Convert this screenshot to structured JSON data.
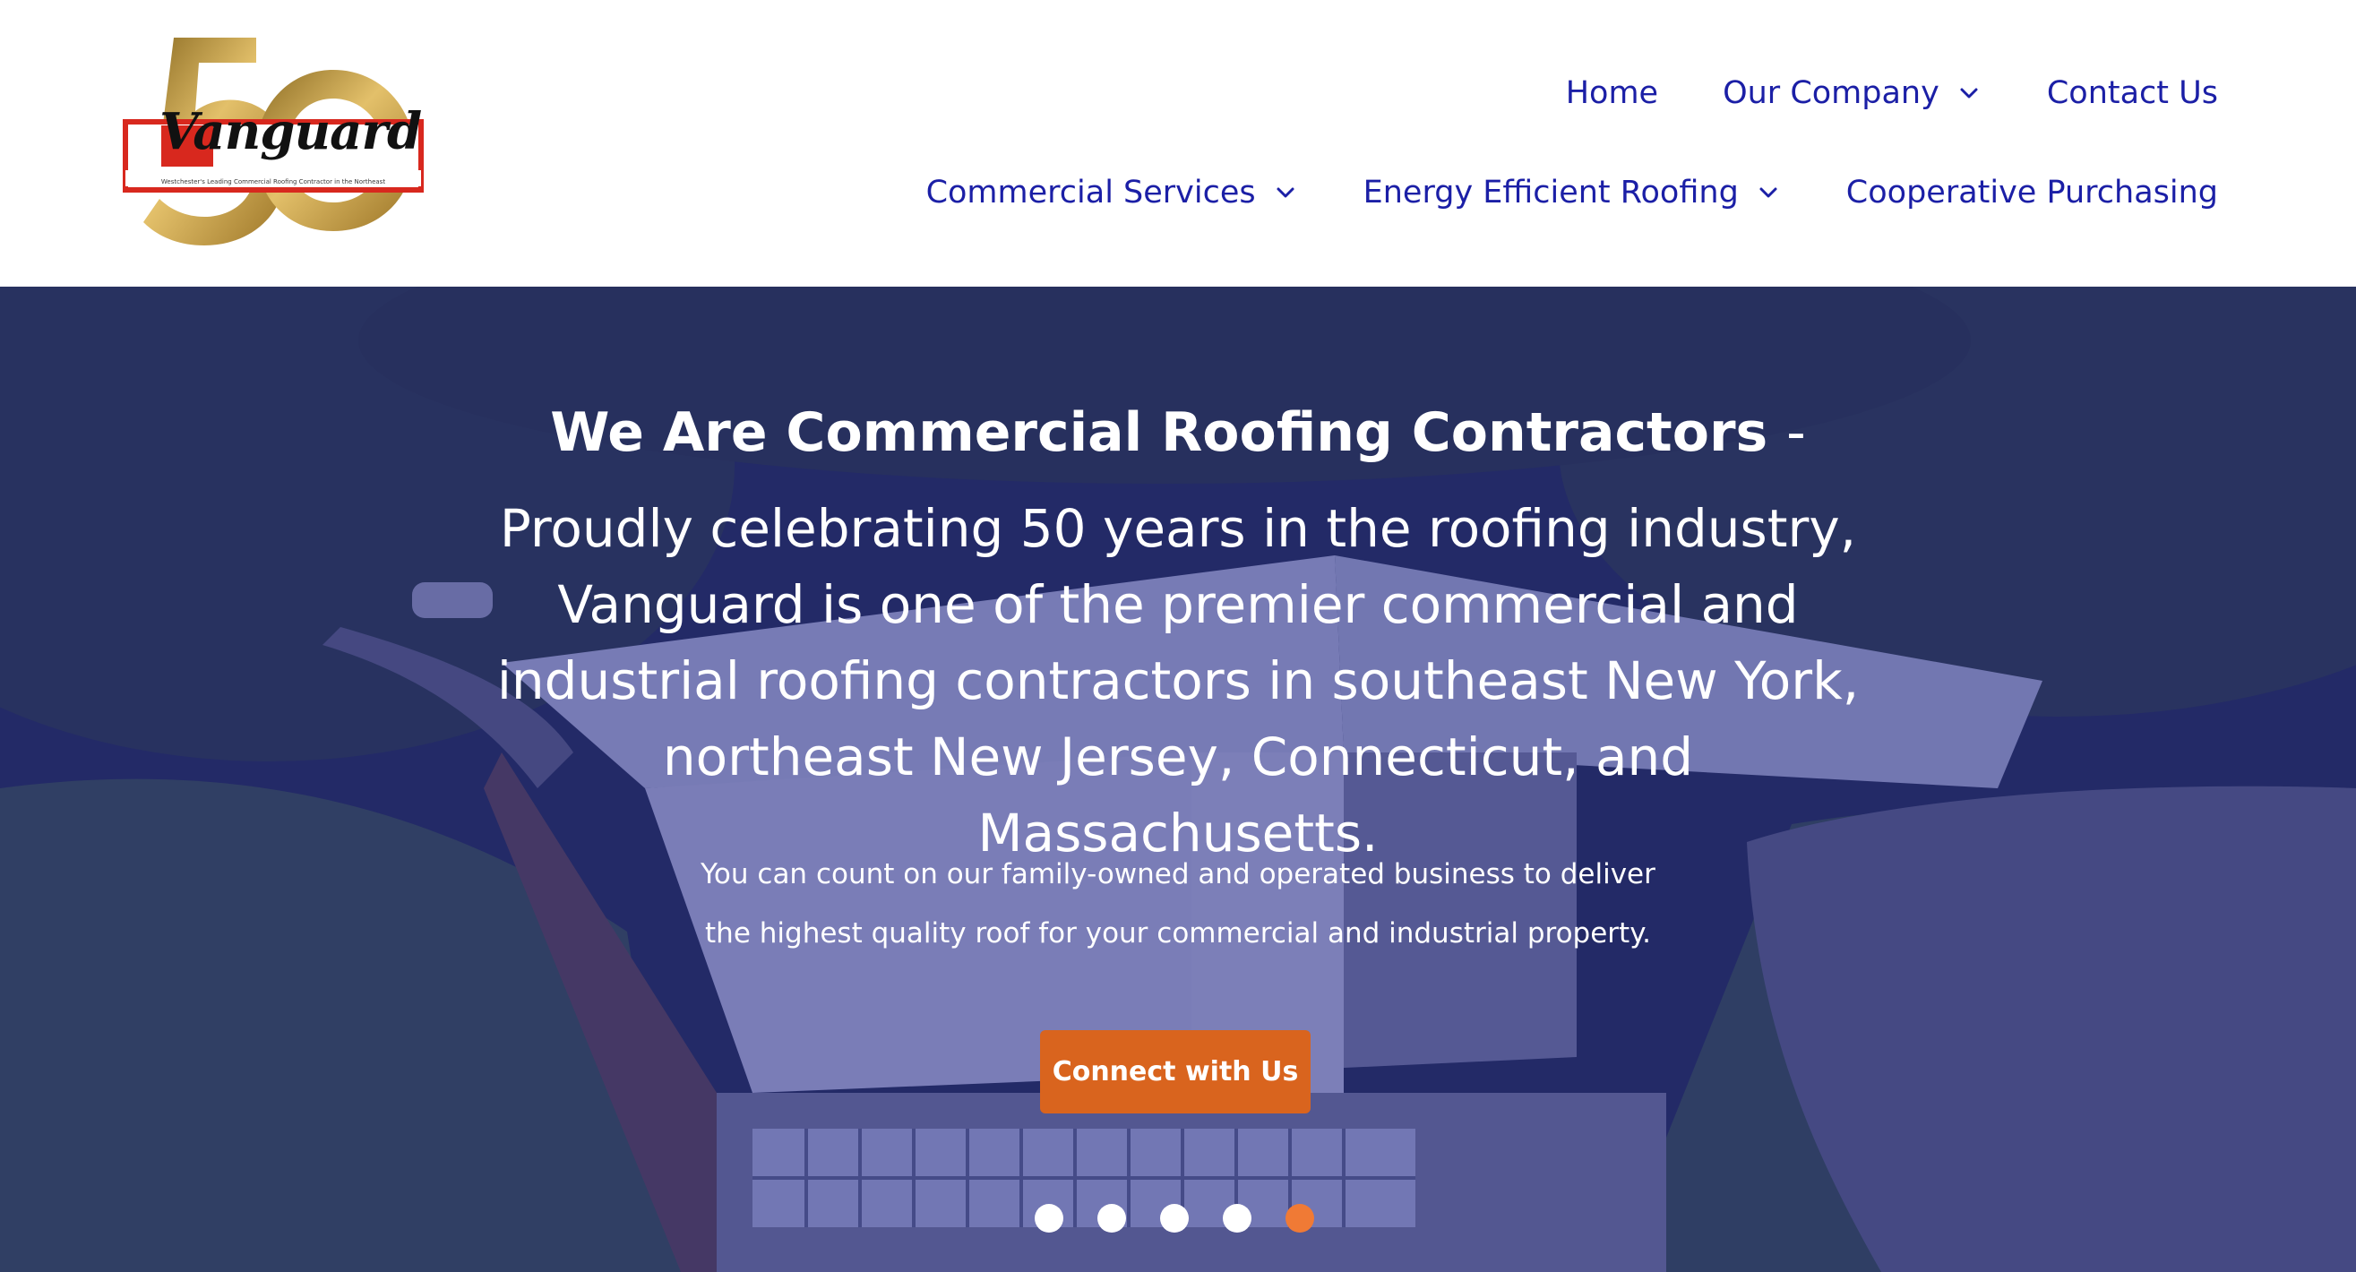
{
  "header": {
    "logo": {
      "word": "Vanguard",
      "tagline": "Westchester's Leading Commercial Roofing Contractor in the Northeast"
    },
    "nav_top": [
      {
        "label": "Home",
        "has_dropdown": false
      },
      {
        "label": "Our Company",
        "has_dropdown": true
      },
      {
        "label": "Contact Us",
        "has_dropdown": false
      }
    ],
    "nav_bottom": [
      {
        "label": "Commercial Services",
        "has_dropdown": true
      },
      {
        "label": "Energy Efficient Roofing",
        "has_dropdown": true
      },
      {
        "label": "Cooperative Purchasing",
        "has_dropdown": false
      }
    ]
  },
  "hero": {
    "title": "We Are Commercial Roofing Contractors",
    "title_suffix": "-",
    "lead": "Proudly celebrating 50 years in the roofing industry, Vanguard is one of the premier commercial and industrial roofing contractors in southeast New York, northeast New Jersey, Connecticut, and Massachusetts.",
    "sub_line1": "You can count on our family-owned and operated business to deliver",
    "sub_line2": "the highest quality roof for your commercial and industrial property.",
    "cta_label": "Connect with Us",
    "slider": {
      "count": 5,
      "active_index": 4
    }
  },
  "colors": {
    "nav_text": "#1b1fa6",
    "overlay": "#26298c",
    "cta": "#d9641e",
    "dot_active": "#f07a35",
    "dot": "#ffffff",
    "logo_gold": "#c9a03c",
    "logo_red": "#d8281e"
  },
  "icons": {
    "dropdown": "chevron-down-icon",
    "logo": "vanguard-50-logo"
  }
}
